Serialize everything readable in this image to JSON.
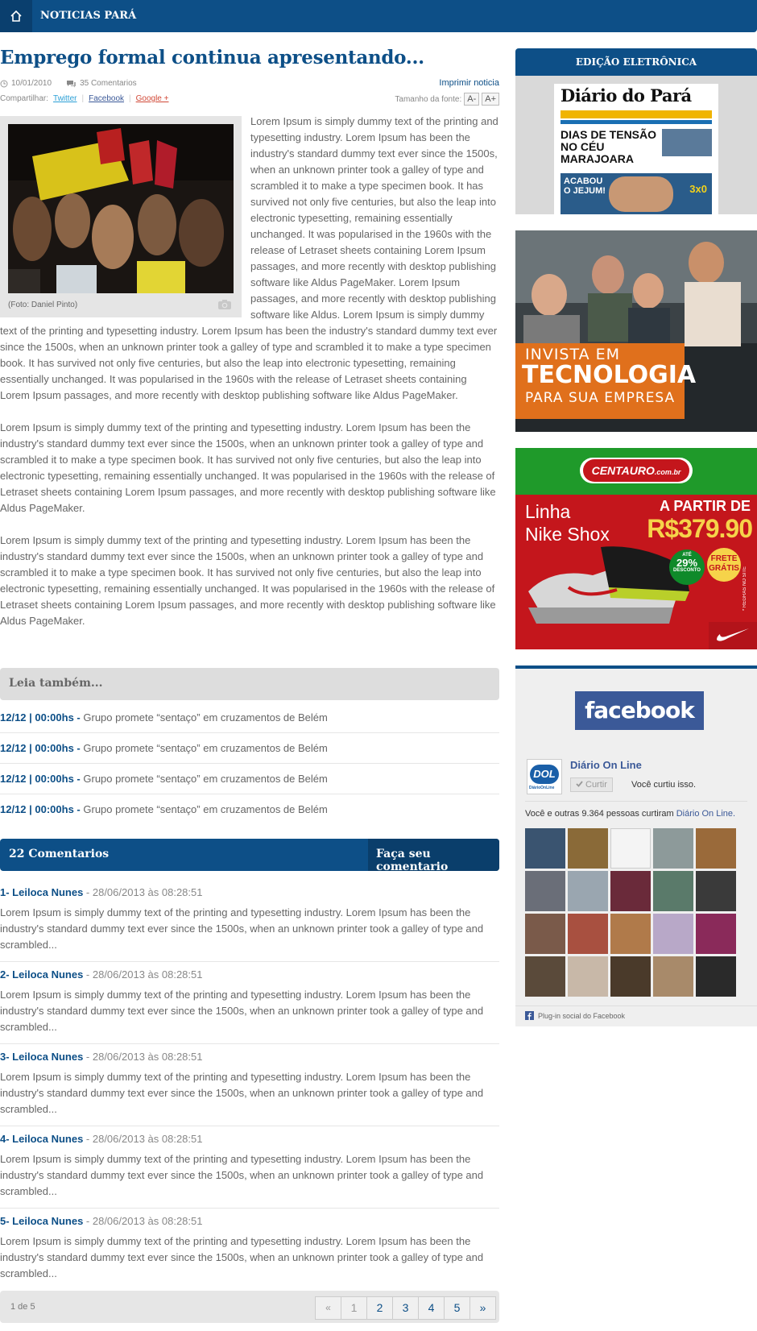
{
  "topbar": {
    "section": "NOTICIAS PARÁ"
  },
  "article": {
    "title": "Emprego formal continua apresentando...",
    "date": "10/01/2010",
    "comments_count": "35 Comentarios",
    "print_label": "Imprimir noticia",
    "share_label": "Compartilhar:",
    "share": [
      "Twitter",
      "Facebook",
      "Google +"
    ],
    "fontsize_label": "Tamanho da fonte:",
    "font_minus": "A-",
    "font_plus": "A+",
    "photo_caption": "(Foto: Daniel Pinto)",
    "para1": "Lorem Ipsum is simply dummy text of the printing and typesetting industry. Lorem Ipsum has been the industry's standard dummy text ever since the 1500s, when an unknown printer took a galley of type and scrambled it to make a type specimen book. It has survived not only five centuries, but also the leap into electronic typesetting, remaining essentially unchanged. It was popularised in the 1960s with the release of Letraset sheets containing Lorem Ipsum passages, and more recently with desktop publishing software like Aldus PageMaker. Lorem Ipsum passages, and more recently with desktop publishing software like Aldus. Lorem Ipsum is simply dummy text of the printing and typesetting industry. Lorem Ipsum has been the industry's standard dummy text ever since the 1500s, when an unknown printer took a galley of type and scrambled it to make a type specimen book. It has survived not only five centuries, but also the leap into electronic typesetting, remaining essentially unchanged. It was popularised in the 1960s with the release of Letraset sheets containing Lorem Ipsum passages, and more recently with desktop publishing software like Aldus PageMaker.",
    "para2": "Lorem Ipsum is simply dummy text of the printing and typesetting industry. Lorem Ipsum has been the industry's standard dummy text ever since the 1500s, when an unknown printer took a galley of type and scrambled it to make a type specimen book. It has survived not only five centuries, but also the leap into electronic typesetting, remaining essentially unchanged. It was popularised in the 1960s with the release of Letraset sheets containing Lorem Ipsum passages, and more recently with desktop publishing software like Aldus PageMaker.",
    "para3": "Lorem Ipsum is simply dummy text of the printing and typesetting industry. Lorem Ipsum has been the industry's standard dummy text ever since the 1500s, when an unknown printer took a galley of type and scrambled it to make a type specimen book. It has survived not only five centuries, but also the leap into electronic typesetting, remaining essentially unchanged. It was popularised in the 1960s with the release of Letraset sheets containing Lorem Ipsum passages, and more recently with desktop publishing software like Aldus PageMaker."
  },
  "related": {
    "heading": "Leia também...",
    "items": [
      {
        "time": "12/12 | 00:00hs -",
        "text": " Grupo promete “sentaço” em cruzamentos de Belém"
      },
      {
        "time": "12/12 | 00:00hs -",
        "text": " Grupo promete “sentaço” em cruzamentos de Belém"
      },
      {
        "time": "12/12 | 00:00hs -",
        "text": " Grupo promete “sentaço” em cruzamentos de Belém"
      },
      {
        "time": "12/12 | 00:00hs -",
        "text": " Grupo promete “sentaço” em cruzamentos de Belém"
      }
    ]
  },
  "comments": {
    "heading": "22 Comentarios",
    "cta": "Faça seu comentario",
    "items": [
      {
        "author": "1- Leiloca Nunes",
        "date": " - 28/06/2013 às 08:28:51",
        "text": "Lorem Ipsum is simply dummy text of the printing and typesetting industry. Lorem Ipsum has been the industry's standard dummy text ever since the 1500s, when an unknown printer took a galley of type and scrambled..."
      },
      {
        "author": "2- Leiloca Nunes",
        "date": " - 28/06/2013 às 08:28:51",
        "text": "Lorem Ipsum is simply dummy text of the printing and typesetting industry. Lorem Ipsum has been the industry's standard dummy text ever since the 1500s, when an unknown printer took a galley of type and scrambled..."
      },
      {
        "author": "3- Leiloca Nunes",
        "date": " - 28/06/2013 às 08:28:51",
        "text": "Lorem Ipsum is simply dummy text of the printing and typesetting industry. Lorem Ipsum has been the industry's standard dummy text ever since the 1500s, when an unknown printer took a galley of type and scrambled..."
      },
      {
        "author": "4- Leiloca Nunes",
        "date": " - 28/06/2013 às 08:28:51",
        "text": "Lorem Ipsum is simply dummy text of the printing and typesetting industry. Lorem Ipsum has been the industry's standard dummy text ever since the 1500s, when an unknown printer took a galley of type and scrambled..."
      },
      {
        "author": "5- Leiloca Nunes",
        "date": " - 28/06/2013 às 08:28:51",
        "text": "Lorem Ipsum is simply dummy text of the printing and typesetting industry. Lorem Ipsum has been the industry's standard dummy text ever since the 1500s, when an unknown printer took a galley of type and scrambled..."
      }
    ]
  },
  "pagination": {
    "info": "1 de 5",
    "prev": "«",
    "pages": [
      "1",
      "2",
      "3",
      "4",
      "5"
    ],
    "next": "»"
  },
  "sidebar": {
    "edition_heading": "EDIÇÃO ELETRÔNICA",
    "paper": {
      "name": "Diário do Pará",
      "headline1": "DIAS DE TENSÃO",
      "headline2": "NO CÉU MARAJOARA",
      "headline3": "ACABOU",
      "headline4": "O JEJUM!",
      "score": "3x0"
    },
    "ad1": {
      "line1": "INVISTA EM",
      "line2": "TECNOLOGIA",
      "line3": "PARA SUA EMPRESA"
    },
    "ad2": {
      "brand": "CENTAURO",
      "brand_suffix": ".com.br",
      "product1": "Linha",
      "product2": "Nike Shox",
      "from": "A PARTIR DE",
      "price": "R$379.90",
      "discount_pre": "ATÉ",
      "discount": "29%",
      "discount_post": "DESCONTO",
      "frete": "FRETE GRÁTIS",
      "regras": "* REGRAS NO SITE"
    },
    "facebook": {
      "logo": "facebook",
      "page_name": "Diário On Line",
      "like_button": "Curtir",
      "liked": "Você curtiu isso.",
      "people_prefix": "Você e outras 9.364 pessoas curtiram ",
      "people_page": "Diário On Line.",
      "avatar_label": "DOL",
      "avatar_sub": "DiárioOnLine",
      "plugin": "Plug-in social do Facebook"
    }
  },
  "colors": {
    "brand": "#0d4f87",
    "brand_dark": "#0a3e6b",
    "facebook": "#3b5998"
  },
  "icons": [
    "home-icon",
    "clock-icon",
    "comment-icon",
    "camera-icon",
    "facebook-small-icon",
    "check-icon"
  ]
}
